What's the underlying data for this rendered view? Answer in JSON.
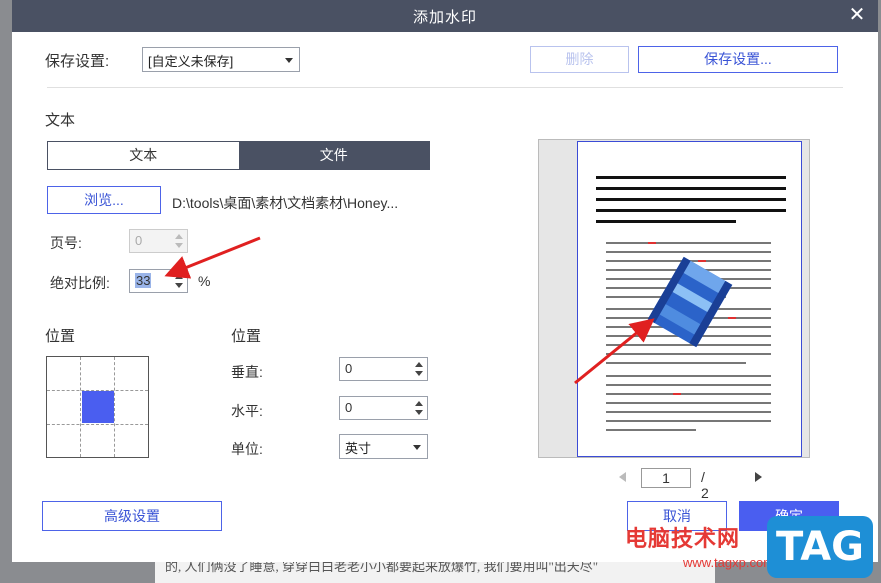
{
  "dialog": {
    "title": "添加水印",
    "close_glyph": "✕"
  },
  "save_settings": {
    "label": "保存设置:",
    "preset_value": "[自定义未保存]",
    "delete_label": "删除",
    "save_label": "保存设置..."
  },
  "text_section": {
    "heading": "文本",
    "tabs": [
      {
        "label": "文本",
        "active": false
      },
      {
        "label": "文件",
        "active": true
      }
    ],
    "browse_label": "浏览...",
    "file_path": "D:\\tools\\桌面\\素材\\文档素材\\Honey...",
    "page_label": "页号:",
    "page_value": "0",
    "scale_label": "绝对比例:",
    "scale_value": "33",
    "scale_unit": "%"
  },
  "position_left": {
    "heading": "位置"
  },
  "position_right": {
    "heading": "位置",
    "vertical_label": "垂直:",
    "vertical_value": "0",
    "horizontal_label": "水平:",
    "horizontal_value": "0",
    "unit_label": "单位:",
    "unit_value": "英寸"
  },
  "preview": {
    "current_page": "1",
    "total_pages": "/ 2"
  },
  "footer": {
    "advanced_label": "高级设置",
    "cancel_label": "取消",
    "ok_label": "确定"
  },
  "background_doc": {
    "line": "的, 人们俩没了睡意, 穿穿白白老老小小都要起来放爆竹, 我们要用叫\"出天尽\""
  },
  "site_watermark": {
    "name": "电脑技术网",
    "url": "www.tagxp.com",
    "badge": "TAG"
  },
  "colors": {
    "titlebar": "#4a5163",
    "accent": "#4a5ef0",
    "annotation_arrow": "#e02020"
  }
}
